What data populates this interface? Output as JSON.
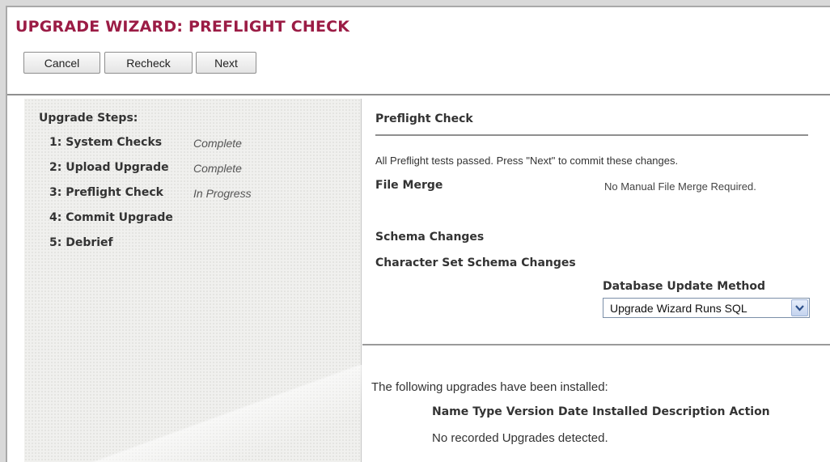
{
  "page": {
    "title": "UPGRADE WIZARD: PREFLIGHT CHECK"
  },
  "toolbar": {
    "cancel_label": "Cancel",
    "recheck_label": "Recheck",
    "next_label": "Next"
  },
  "sidebar": {
    "heading": "Upgrade Steps:",
    "steps": [
      {
        "label": "1: System Checks",
        "status": "Complete"
      },
      {
        "label": "2: Upload Upgrade",
        "status": "Complete"
      },
      {
        "label": "3: Preflight Check",
        "status": "In Progress"
      },
      {
        "label": "4: Commit Upgrade",
        "status": ""
      },
      {
        "label": "5: Debrief",
        "status": ""
      }
    ]
  },
  "main": {
    "title": "Preflight Check",
    "message": "All Preflight tests passed. Press \"Next\" to commit these changes.",
    "file_merge": {
      "label": "File Merge",
      "value": "No Manual File Merge Required."
    },
    "schema_changes_label": "Schema Changes",
    "charset_schema_changes_label": "Character Set Schema Changes",
    "db_update": {
      "label": "Database Update Method",
      "selected": "Upgrade Wizard Runs SQL"
    },
    "installed": {
      "message": "The following upgrades have been installed:",
      "columns": [
        "Name",
        "Type",
        "Version",
        "Date Installed",
        "Description",
        "Action"
      ],
      "empty_message": "No recorded Upgrades detected."
    }
  },
  "icons": {
    "select_arrow": "chevron-down-icon"
  },
  "colors": {
    "title": "#9b1c45",
    "panel_bg": "#f0f0ee"
  }
}
